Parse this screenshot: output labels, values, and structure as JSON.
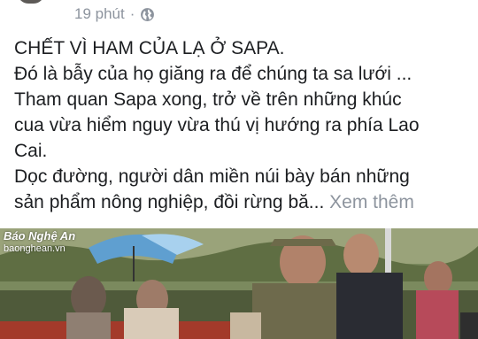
{
  "post": {
    "time": "19 phút",
    "separator": "·",
    "privacy_icon": "globe-icon",
    "lines": [
      "CHẾT VÌ HAM CỦA LẠ Ở SAPA.",
      "Đó là bẫy của họ giăng ra để chúng ta sa lưới ...",
      "Tham quan Sapa xong, trở về trên những khúc",
      "cua vừa hiểm nguy vừa thú vị hướng ra phía Lao",
      "Cai.",
      "Dọc đường, người dân miền núi bày bán những",
      "sản phẩm nông nghiệp, đồi rừng bă..."
    ],
    "see_more": "Xem thêm"
  },
  "photo": {
    "watermark_brand": "Báo Nghệ An",
    "watermark_url": "baonghean.vn"
  },
  "colors": {
    "text": "#1c1e21",
    "meta": "#8d949e"
  }
}
